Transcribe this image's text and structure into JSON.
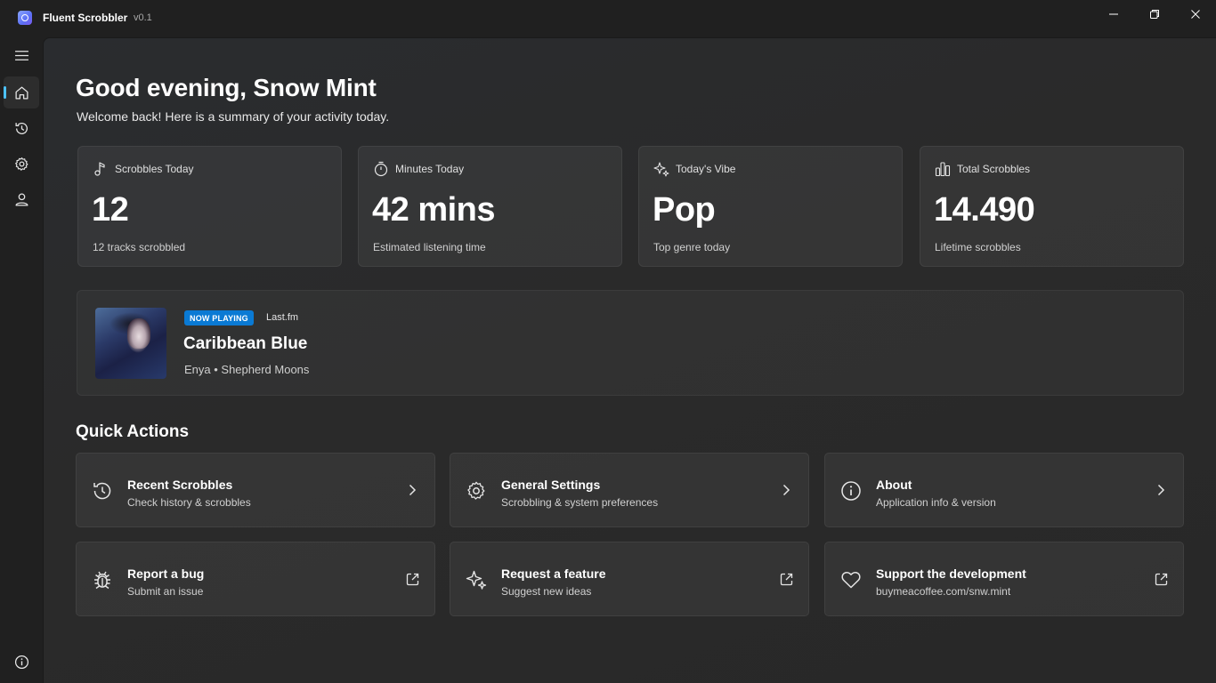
{
  "window": {
    "title": "Fluent Scrobbler",
    "version": "v0.1"
  },
  "sidebar": {
    "items": [
      {
        "name": "menu-icon"
      },
      {
        "name": "home-icon",
        "active": true
      },
      {
        "name": "history-icon"
      },
      {
        "name": "settings-icon"
      },
      {
        "name": "profile-icon"
      },
      {
        "name": "info-icon"
      }
    ]
  },
  "header": {
    "greeting": "Good evening, Snow Mint",
    "subtitle": "Welcome back! Here is a summary of your activity today."
  },
  "stats": [
    {
      "icon": "music-note-icon",
      "label": "Scrobbles Today",
      "value": "12",
      "caption": "12 tracks scrobbled"
    },
    {
      "icon": "timer-icon",
      "label": "Minutes Today",
      "value": "42 mins",
      "caption": "Estimated listening time"
    },
    {
      "icon": "sparkle-icon",
      "label": "Today's Vibe",
      "value": "Pop",
      "caption": "Top genre today"
    },
    {
      "icon": "bar-chart-icon",
      "label": "Total Scrobbles",
      "value": "14.490",
      "caption": "Lifetime scrobbles"
    }
  ],
  "now_playing": {
    "badge": "NOW PLAYING",
    "source": "Last.fm",
    "title": "Caribbean Blue",
    "subtitle": "Enya • Shepherd Moons"
  },
  "quick_actions": {
    "title": "Quick Actions",
    "items": [
      {
        "icon": "history-icon",
        "title": "Recent Scrobbles",
        "desc": "Check history & scrobbles",
        "kind": "chevron"
      },
      {
        "icon": "settings-icon",
        "title": "General Settings",
        "desc": "Scrobbling & system preferences",
        "kind": "chevron"
      },
      {
        "icon": "info-icon",
        "title": "About",
        "desc": "Application info & version",
        "kind": "chevron"
      },
      {
        "icon": "bug-icon",
        "title": "Report a bug",
        "desc": "Submit an issue",
        "kind": "external"
      },
      {
        "icon": "sparkle-icon",
        "title": "Request a feature",
        "desc": "Suggest new ideas",
        "kind": "external"
      },
      {
        "icon": "heart-icon",
        "title": "Support the development",
        "desc": "buymeacoffee.com/snw.mint",
        "kind": "external"
      }
    ]
  },
  "colors": {
    "accent": "#4cc2ff",
    "badge": "#0a7ad4",
    "background": "#202020"
  }
}
